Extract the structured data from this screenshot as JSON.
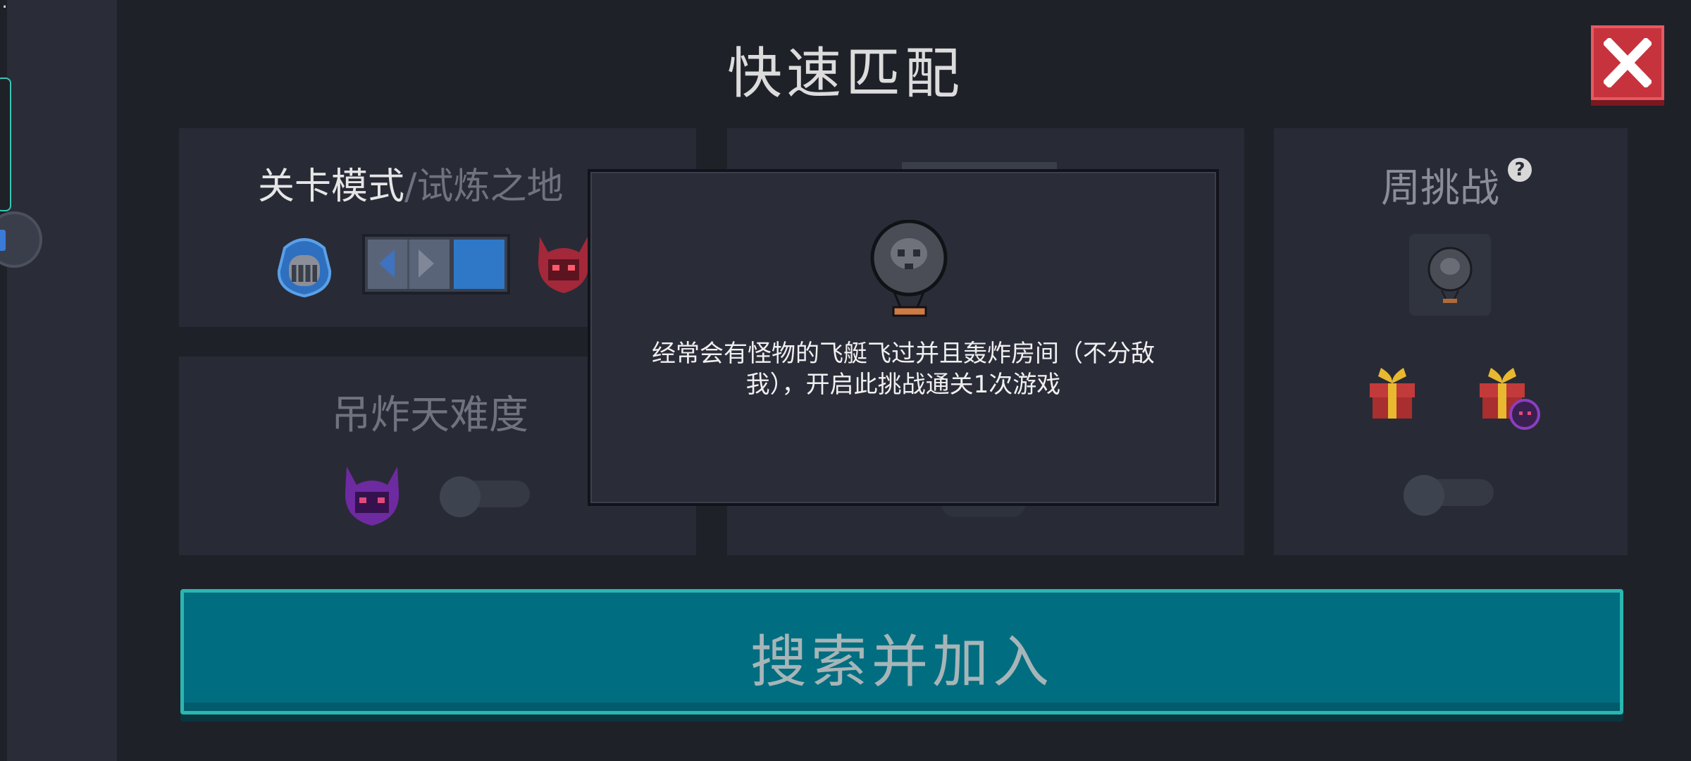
{
  "version": ".0.2",
  "title": "快速匹配",
  "colors": {
    "accent": "#006e80",
    "close": "#c7333d",
    "panel": "#282b35",
    "background": "#1f2129"
  },
  "mode_panel": {
    "mode": "关卡模式",
    "separator": "/",
    "sub_mode": "试炼之地"
  },
  "bomb_panel": {
    "label": "吊炸天难度",
    "enabled": false
  },
  "weekly_panel": {
    "label": "周挑战",
    "help_icon": "?",
    "enabled": false
  },
  "popup": {
    "description": "经常会有怪物的飞艇飞过并且轰炸房间（不分敌我），开启此挑战通关1次游戏"
  },
  "search_button": {
    "label": "搜索并加入"
  },
  "icons": [
    "close-icon",
    "knight-helmet-icon",
    "demon-helmet-icon",
    "purple-demon-icon",
    "skull-balloon-icon",
    "gift-icon",
    "help-icon"
  ]
}
